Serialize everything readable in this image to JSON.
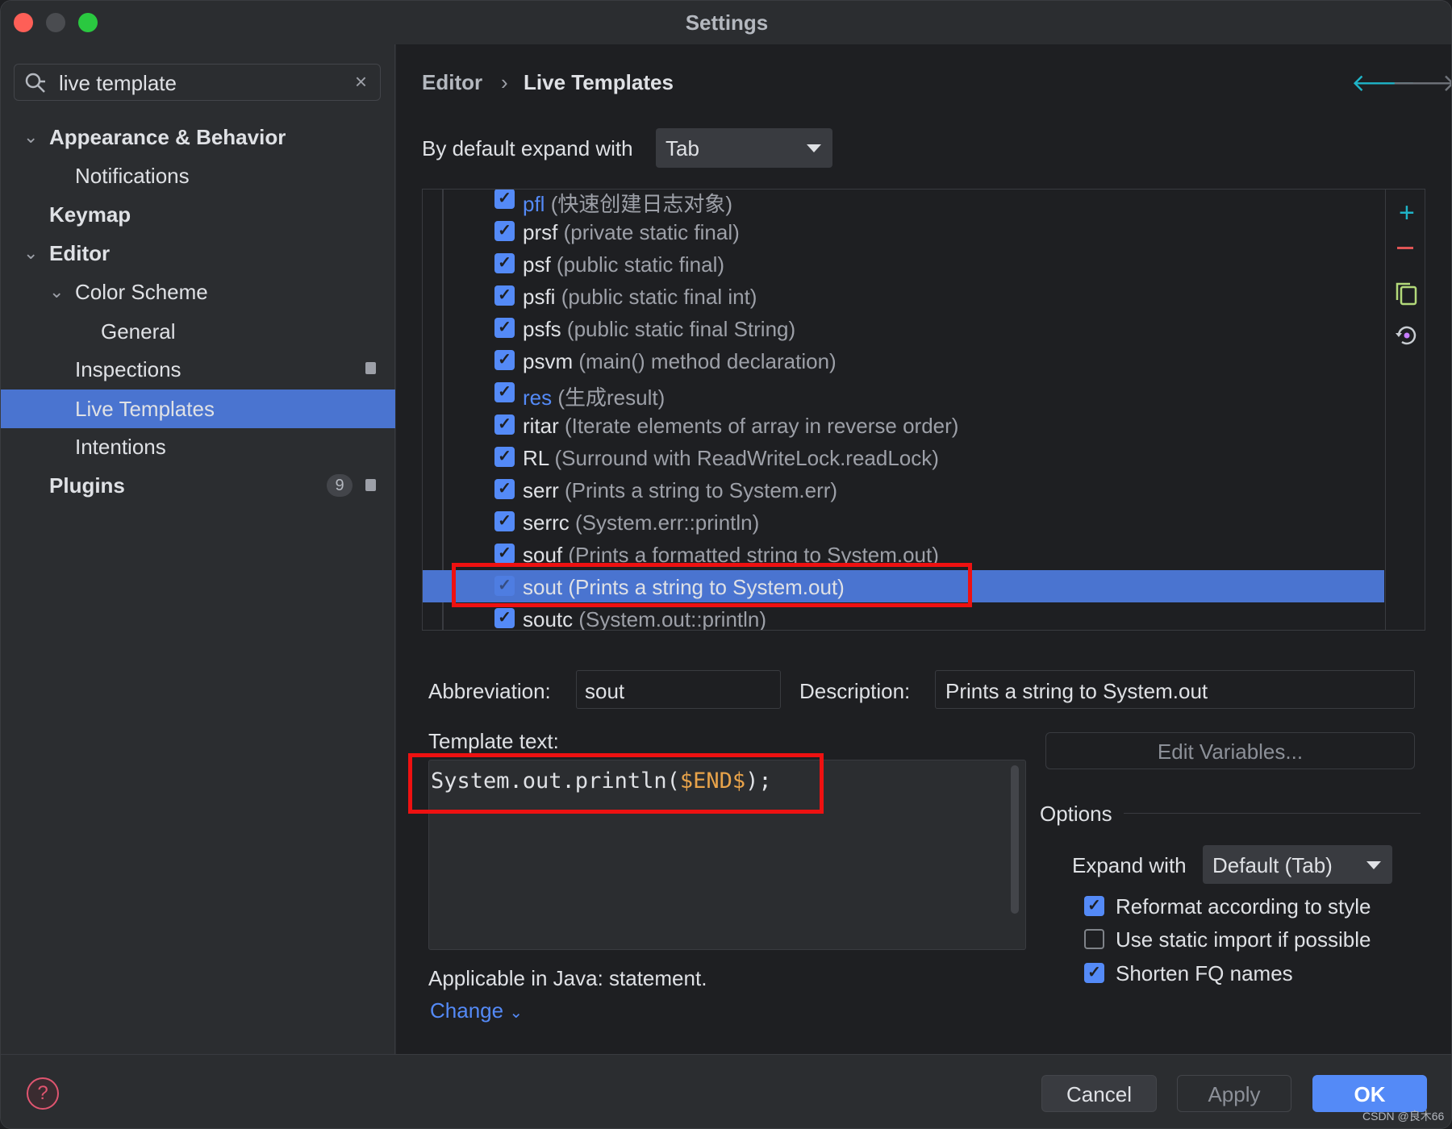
{
  "window": {
    "title": "Settings"
  },
  "colors": {
    "accent": "#548af7",
    "selection": "#4a74d0",
    "highlight_box": "#ee1111",
    "variable": "#e8a34a",
    "add": "#1fb4c8",
    "remove": "#e05555",
    "copy": "#b3d97a"
  },
  "search": {
    "value": "live template",
    "icon": "search-icon",
    "clear_icon": "close-icon"
  },
  "sidebar": {
    "items": [
      {
        "label": "Appearance & Behavior"
      },
      {
        "label": "Notifications"
      },
      {
        "label": "Keymap"
      },
      {
        "label": "Editor"
      },
      {
        "label": "Color Scheme"
      },
      {
        "label": "General"
      },
      {
        "label": "Inspections"
      },
      {
        "label": "Live Templates"
      },
      {
        "label": "Intentions"
      },
      {
        "label": "Plugins",
        "badge": "9"
      }
    ]
  },
  "breadcrumb": {
    "parent": "Editor",
    "current": "Live Templates"
  },
  "expand_default": {
    "label": "By default expand with",
    "value": "Tab"
  },
  "templates": [
    {
      "abbr": "pfl",
      "desc": "(快速创建日志对象)",
      "checked": true,
      "custom": true
    },
    {
      "abbr": "prsf",
      "desc": "(private static final)",
      "checked": true
    },
    {
      "abbr": "psf",
      "desc": "(public static final)",
      "checked": true
    },
    {
      "abbr": "psfi",
      "desc": "(public static final int)",
      "checked": true
    },
    {
      "abbr": "psfs",
      "desc": "(public static final String)",
      "checked": true
    },
    {
      "abbr": "psvm",
      "desc": "(main() method declaration)",
      "checked": true
    },
    {
      "abbr": "res",
      "desc": "(生成result)",
      "checked": true,
      "custom": true
    },
    {
      "abbr": "ritar",
      "desc": "(Iterate elements of array in reverse order)",
      "checked": true
    },
    {
      "abbr": "RL",
      "desc": "(Surround with ReadWriteLock.readLock)",
      "checked": true
    },
    {
      "abbr": "serr",
      "desc": "(Prints a string to System.err)",
      "checked": true
    },
    {
      "abbr": "serrc",
      "desc": "(System.err::println)",
      "checked": true
    },
    {
      "abbr": "souf",
      "desc": "(Prints a formatted string to System.out)",
      "checked": true
    },
    {
      "abbr": "sout",
      "desc": "(Prints a string to System.out)",
      "checked": true,
      "selected": true
    },
    {
      "abbr": "soutc",
      "desc": "(System.out::println)",
      "checked": true
    }
  ],
  "details": {
    "abbr_label": "Abbreviation:",
    "abbr_value": "sout",
    "desc_label": "Description:",
    "desc_value": "Prints a string to System.out",
    "template_label": "Template text:",
    "template_code": "System.out.println(",
    "template_var": "$END$",
    "template_end": ");",
    "edit_variables": "Edit Variables...",
    "applicable": "Applicable in Java: statement.",
    "change": "Change"
  },
  "options": {
    "title": "Options",
    "expand_label": "Expand with",
    "expand_value": "Default (Tab)",
    "checks": [
      {
        "label": "Reformat according to style",
        "checked": true
      },
      {
        "label": "Use static import if possible",
        "checked": false
      },
      {
        "label": "Shorten FQ names",
        "checked": true
      }
    ]
  },
  "footer": {
    "cancel": "Cancel",
    "apply": "Apply",
    "ok": "OK",
    "watermark": "CSDN @良木66"
  }
}
